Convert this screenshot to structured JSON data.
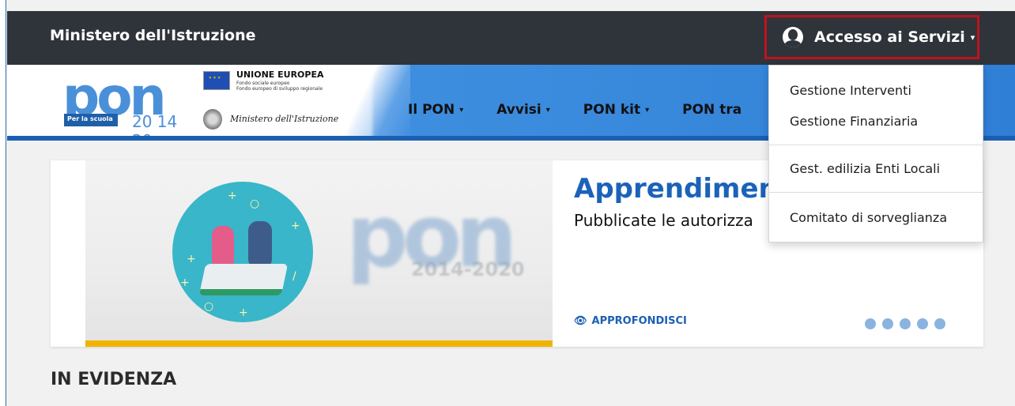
{
  "header": {
    "site_title": "Ministero dell'Istruzione",
    "access_label": "Accesso ai Servizi",
    "access_caret": "▾"
  },
  "logos": {
    "pon_text": "pon",
    "pon_tag": "Per la scuola",
    "pon_years": "20 14 20",
    "eu_title": "UNIONE EUROPEA",
    "eu_sub_1": "Fondo sociale europeo",
    "eu_sub_2": "Fondo europeo di sviluppo regionale",
    "ministero": "Ministero dell'Istruzione"
  },
  "nav": {
    "items": [
      {
        "label": "Il PON"
      },
      {
        "label": "Avvisi"
      },
      {
        "label": "PON kit"
      },
      {
        "label": "PON tra"
      }
    ],
    "caret": "▾"
  },
  "carousel": {
    "title": "Apprendiment",
    "subtitle": "Pubblicate le autorizza",
    "link_label": "APPROFONDISCI",
    "slide_count": 5,
    "bg_brand_text": "pon",
    "bg_brand_years": "2014-2020"
  },
  "section": {
    "title": "IN EVIDENZA"
  },
  "dropdown": {
    "items": [
      "Gestione Interventi",
      "Gestione Finanziaria",
      "Gest. edilizia Enti Locali",
      "Comitato di sorveglianza"
    ]
  },
  "colors": {
    "topbar": "#2f343b",
    "highlight_border": "#c0121b",
    "nav_blue": "#2f7fd6",
    "title_blue": "#1b63b8",
    "accent_yellow": "#f0b400"
  }
}
